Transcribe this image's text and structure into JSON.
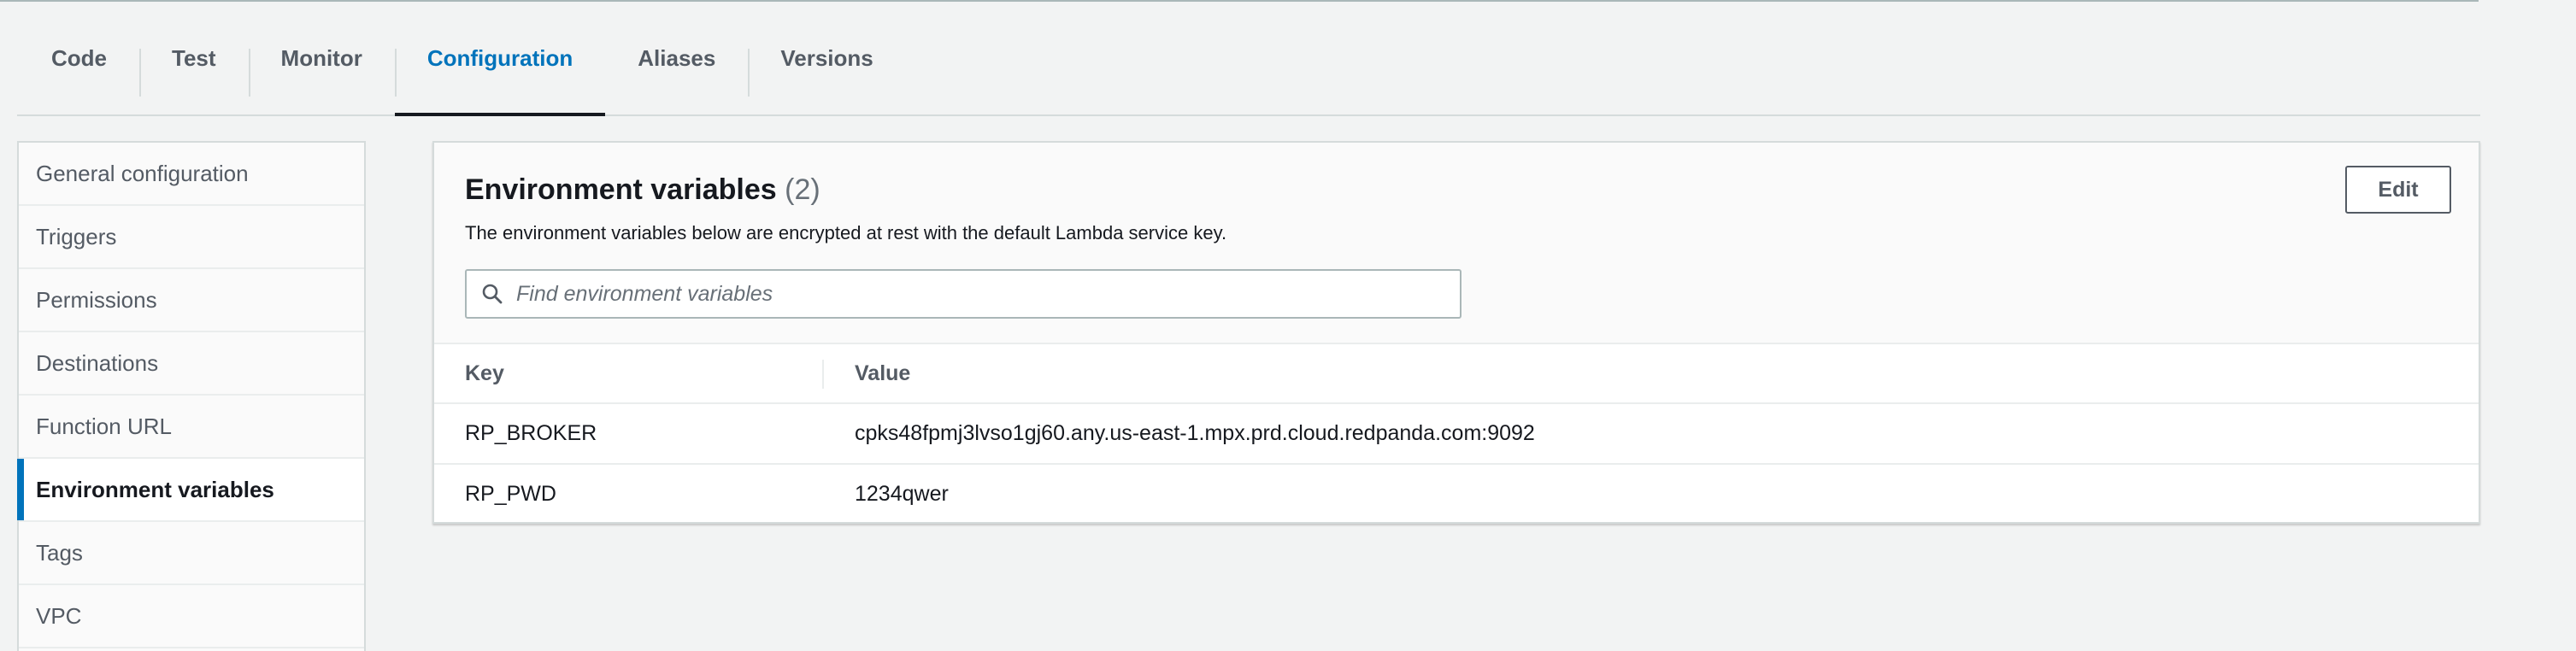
{
  "tabs": [
    {
      "label": "Code"
    },
    {
      "label": "Test"
    },
    {
      "label": "Monitor"
    },
    {
      "label": "Configuration"
    },
    {
      "label": "Aliases"
    },
    {
      "label": "Versions"
    }
  ],
  "active_tab": "Configuration",
  "sidebar": {
    "items": [
      {
        "label": "General configuration"
      },
      {
        "label": "Triggers"
      },
      {
        "label": "Permissions"
      },
      {
        "label": "Destinations"
      },
      {
        "label": "Function URL"
      },
      {
        "label": "Environment variables"
      },
      {
        "label": "Tags"
      },
      {
        "label": "VPC"
      }
    ],
    "active_item": "Environment variables"
  },
  "panel": {
    "title": "Environment variables",
    "count": "(2)",
    "description": "The environment variables below are encrypted at rest with the default Lambda service key.",
    "edit_label": "Edit",
    "search": {
      "placeholder": "Find environment variables",
      "value": ""
    },
    "table": {
      "columns": [
        "Key",
        "Value"
      ],
      "rows": [
        {
          "key": "RP_BROKER",
          "value": "cpks48fpmj3lvso1gj60.any.us-east-1.mpx.prd.cloud.redpanda.com:9092"
        },
        {
          "key": "RP_PWD",
          "value": "1234qwer"
        }
      ]
    }
  },
  "icons": {
    "search": "search-icon"
  },
  "colors": {
    "accent": "#0073bb",
    "text": "#16191f",
    "muted": "#545b64",
    "background": "#f2f3f3"
  }
}
